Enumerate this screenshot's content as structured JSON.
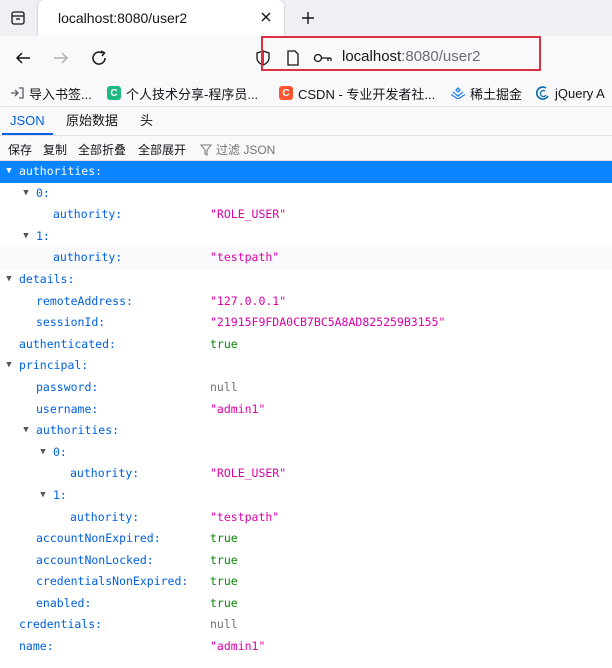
{
  "tab": {
    "title": "localhost:8080/user2"
  },
  "url": {
    "host": "localhost",
    "rest": ":8080/user2"
  },
  "bookmarks": [
    {
      "label": "导入书签...",
      "icon": "import-icon",
      "color": "#5b5b66"
    },
    {
      "label": "个人技术分享-程序员...",
      "icon": "c-logo-icon",
      "color": "#1eb980"
    },
    {
      "label": "CSDN - 专业开发者社...",
      "icon": "csdn-logo-icon",
      "color": "#fc5531"
    },
    {
      "label": "稀土掘金",
      "icon": "juejin-logo-icon",
      "color": "#1e80ff"
    },
    {
      "label": "jQuery A",
      "icon": "jquery-logo-icon",
      "color": "#0769ad"
    }
  ],
  "viewer_tabs": [
    "JSON",
    "原始数据",
    "头"
  ],
  "toolbar": {
    "save": "保存",
    "copy": "复制",
    "collapse_all": "全部折叠",
    "expand_all": "全部展开",
    "filter": "过滤 JSON"
  },
  "rows": [
    {
      "depth": 0,
      "key": "authorities:",
      "twisty": true,
      "value": "",
      "type": "",
      "sel": true
    },
    {
      "depth": 1,
      "key": "0:",
      "twisty": true,
      "value": "",
      "type": ""
    },
    {
      "depth": 2,
      "key": "authority:",
      "twisty": false,
      "value": "\"ROLE_USER\"",
      "type": "str"
    },
    {
      "depth": 1,
      "key": "1:",
      "twisty": true,
      "value": "",
      "type": ""
    },
    {
      "depth": 2,
      "key": "authority:",
      "twisty": false,
      "value": "\"testpath\"",
      "type": "str",
      "alt": true
    },
    {
      "depth": 0,
      "key": "details:",
      "twisty": true,
      "value": "",
      "type": ""
    },
    {
      "depth": 1,
      "key": "remoteAddress:",
      "twisty": false,
      "value": "\"127.0.0.1\"",
      "type": "str"
    },
    {
      "depth": 1,
      "key": "sessionId:",
      "twisty": false,
      "value": "\"21915F9FDA0CB7BC5A8AD825259B3155\"",
      "type": "str"
    },
    {
      "depth": 0,
      "key": "authenticated:",
      "twisty": false,
      "value": "true",
      "type": "bool"
    },
    {
      "depth": 0,
      "key": "principal:",
      "twisty": true,
      "value": "",
      "type": ""
    },
    {
      "depth": 1,
      "key": "password:",
      "twisty": false,
      "value": "null",
      "type": "null"
    },
    {
      "depth": 1,
      "key": "username:",
      "twisty": false,
      "value": "\"admin1\"",
      "type": "str"
    },
    {
      "depth": 1,
      "key": "authorities:",
      "twisty": true,
      "value": "",
      "type": ""
    },
    {
      "depth": 2,
      "key": "0:",
      "twisty": true,
      "value": "",
      "type": ""
    },
    {
      "depth": 3,
      "key": "authority:",
      "twisty": false,
      "value": "\"ROLE_USER\"",
      "type": "str"
    },
    {
      "depth": 2,
      "key": "1:",
      "twisty": true,
      "value": "",
      "type": ""
    },
    {
      "depth": 3,
      "key": "authority:",
      "twisty": false,
      "value": "\"testpath\"",
      "type": "str"
    },
    {
      "depth": 1,
      "key": "accountNonExpired:",
      "twisty": false,
      "value": "true",
      "type": "bool"
    },
    {
      "depth": 1,
      "key": "accountNonLocked:",
      "twisty": false,
      "value": "true",
      "type": "bool"
    },
    {
      "depth": 1,
      "key": "credentialsNonExpired:",
      "twisty": false,
      "value": "true",
      "type": "bool"
    },
    {
      "depth": 1,
      "key": "enabled:",
      "twisty": false,
      "value": "true",
      "type": "bool"
    },
    {
      "depth": 0,
      "key": "credentials:",
      "twisty": false,
      "value": "null",
      "type": "null"
    },
    {
      "depth": 0,
      "key": "name:",
      "twisty": false,
      "value": "\"admin1\"",
      "type": "str"
    }
  ]
}
